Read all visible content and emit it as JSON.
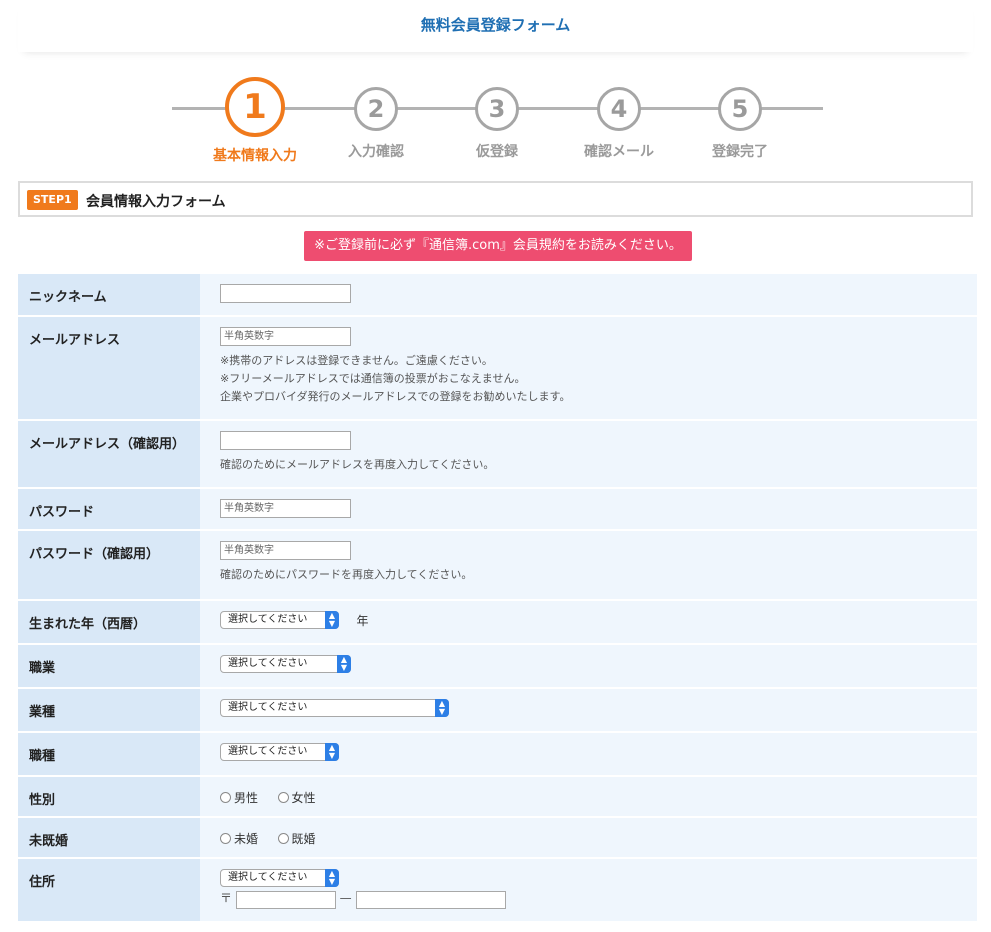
{
  "header": {
    "title": "無料会員登録フォーム"
  },
  "steps": [
    {
      "number": "1",
      "label": "基本情報入力",
      "active": true
    },
    {
      "number": "2",
      "label": "入力確認",
      "active": false
    },
    {
      "number": "3",
      "label": "仮登録",
      "active": false
    },
    {
      "number": "4",
      "label": "確認メール",
      "active": false
    },
    {
      "number": "5",
      "label": "登録完了",
      "active": false
    }
  ],
  "banner": {
    "badge": "STEP1",
    "title": "会員情報入力フォーム"
  },
  "notice": "※ご登録前に必ず『通信簿.com』会員規約をお読みください。",
  "colors": {
    "accent": "#f07a1c",
    "brand": "#1f6fb3",
    "notice": "#ee4d70",
    "label_bg": "#d9e8f7",
    "field_bg": "#eff6fd"
  },
  "form": {
    "nickname": {
      "label": "ニックネーム",
      "value": "",
      "placeholder": ""
    },
    "email": {
      "label": "メールアドレス",
      "placeholder": "半角英数字",
      "notes": [
        "※携帯のアドレスは登録できません。ご遠慮ください。",
        "※フリーメールアドレスでは通信簿の投票がおこなえません。",
        "企業やプロバイダ発行のメールアドレスでの登録をお勧めいたします。"
      ]
    },
    "email_confirm": {
      "label": "メールアドレス（確認用）",
      "placeholder": "",
      "note": "確認のためにメールアドレスを再度入力してください。"
    },
    "password": {
      "label": "パスワード",
      "placeholder": "半角英数字"
    },
    "password_confirm": {
      "label": "パスワード（確認用）",
      "placeholder": "半角英数字",
      "note": "確認のためにパスワードを再度入力してください。"
    },
    "birth_year": {
      "label": "生まれた年（西暦）",
      "selected": "選択してください",
      "suffix": "年"
    },
    "occupation": {
      "label": "職業",
      "selected": "選択してください"
    },
    "industry": {
      "label": "業種",
      "selected": "選択してください"
    },
    "job_type": {
      "label": "職種",
      "selected": "選択してください"
    },
    "gender": {
      "label": "性別",
      "options": [
        "男性",
        "女性"
      ]
    },
    "marital": {
      "label": "未既婚",
      "options": [
        "未婚",
        "既婚"
      ]
    },
    "address": {
      "label": "住所",
      "selected": "選択してください",
      "postal_mark": "〒",
      "postal_dash": "—"
    }
  }
}
